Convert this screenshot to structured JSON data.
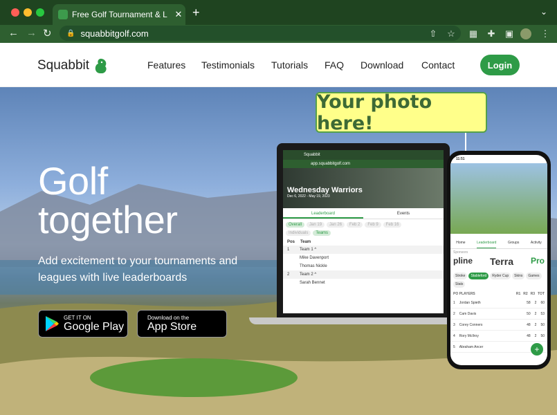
{
  "browser": {
    "tab_title": "Free Golf Tournament & League",
    "tab_close": "✕",
    "new_tab": "+",
    "url": "squabbitgolf.com"
  },
  "nav": {
    "logo_text": "Squabbit",
    "items": [
      "Features",
      "Testimonials",
      "Tutorials",
      "FAQ",
      "Download",
      "Contact"
    ],
    "login": "Login"
  },
  "hero": {
    "headline_1": "Golf",
    "headline_2": "together",
    "subtitle": "Add excitement to your tournaments and leagues with live leaderboards",
    "google_small": "GET IT ON",
    "google_big": "Google Play",
    "apple_small": "Download on the",
    "apple_big": "App Store",
    "callout": "Your photo here!"
  },
  "laptop": {
    "tab": "Squabbit",
    "url": "app.squabbitgolf.com",
    "event_name": "Wednesday Warriors",
    "event_dates": "Dec 6, 2022 - May 19, 2023",
    "tabs": [
      "Leaderboard",
      "Events"
    ],
    "filters": [
      "Overall",
      "Jan 19",
      "Jan 26",
      "Feb 2",
      "Feb 9",
      "Feb 16"
    ],
    "toggles": [
      "Individuals",
      "Teams"
    ],
    "col_pos": "Pos",
    "col_team": "Team",
    "rows": [
      {
        "pos": "1",
        "name": "Team 1 ^"
      },
      {
        "pos": "",
        "name": "Mike Davenport"
      },
      {
        "pos": "",
        "name": "Thomas Nickle"
      },
      {
        "pos": "2",
        "name": "Team 2 ^"
      },
      {
        "pos": "",
        "name": "Sarah Bennet"
      }
    ]
  },
  "phone": {
    "time": "11:51",
    "tabs": [
      "Home",
      "Leaderboard",
      "Groups",
      "Activity"
    ],
    "sponsors_label": "Sponsors",
    "sponsors": [
      "pline",
      "Terra",
      "Pro"
    ],
    "chips": [
      "Stroke",
      "Stableford",
      "Ryder Cup",
      "Skins",
      "Games",
      "Stats"
    ],
    "headers": [
      "PO PLAYERS",
      "R1",
      "R2",
      "R3",
      "TOT"
    ],
    "players": [
      {
        "pos": "1",
        "name": "Jordan Spieth",
        "r1": "58",
        "r2": "2",
        "tot": "60"
      },
      {
        "pos": "2",
        "name": "Cam Davis",
        "r1": "50",
        "r2": "2",
        "tot": "53"
      },
      {
        "pos": "3",
        "name": "Corey Conners",
        "r1": "48",
        "r2": "2",
        "tot": "50"
      },
      {
        "pos": "4",
        "name": "Rory McIlroy",
        "r1": "48",
        "r2": "2",
        "tot": "50"
      },
      {
        "pos": "5",
        "name": "Abraham Ancer",
        "r1": "",
        "r2": "",
        "tot": ""
      }
    ]
  }
}
